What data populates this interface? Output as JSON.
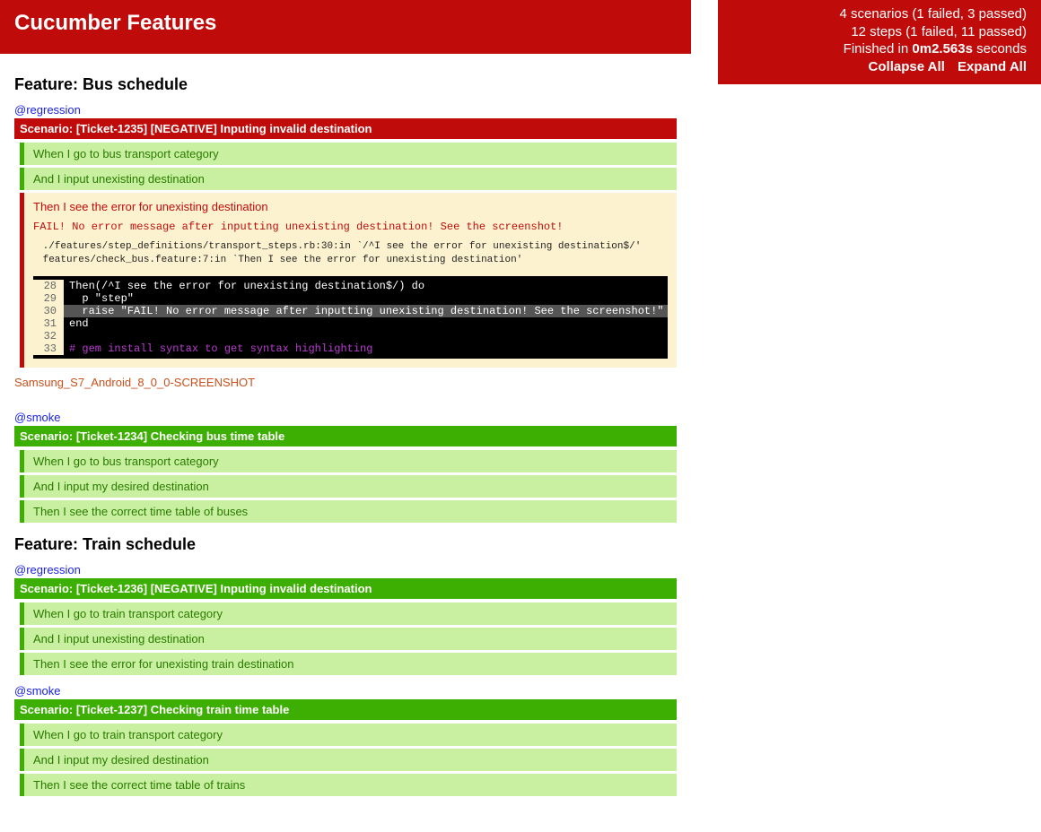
{
  "header": {
    "title": "Cucumber Features"
  },
  "summary": {
    "scenarios": "4 scenarios (1 failed, 3 passed)",
    "steps": "12 steps (1 failed, 11 passed)",
    "finished_prefix": "Finished in ",
    "finished_time": "0m2.563s",
    "finished_suffix": " seconds",
    "collapse": "Collapse All",
    "expand": "Expand All"
  },
  "features": [
    {
      "title": "Feature: Bus schedule",
      "scenarios": [
        {
          "tag": "@regression",
          "status": "failed",
          "name": "Scenario: [Ticket-1235] [NEGATIVE] Inputing invalid destination",
          "steps": [
            {
              "status": "passed",
              "text": "When I go to bus transport category"
            },
            {
              "status": "passed",
              "text": "And I input unexisting destination"
            },
            {
              "status": "failed",
              "text": "Then I see the error for unexisting destination",
              "error": "FAIL! No error message after inputting unexisting destination! See the screenshot!",
              "trace": " ./features/step_definitions/transport_steps.rb:30:in `/^I see the error for unexisting destination$/'\n features/check_bus.feature:7:in `Then I see the error for unexisting destination'",
              "code": [
                {
                  "ln": "28",
                  "src": "Then(/^I see the error for unexisting destination$/) do",
                  "hl": false,
                  "comment": false
                },
                {
                  "ln": "29",
                  "src": "  p \"step\"",
                  "hl": false,
                  "comment": false
                },
                {
                  "ln": "30",
                  "src": "  raise \"FAIL! No error message after inputting unexisting destination! See the screenshot!\"",
                  "hl": true,
                  "comment": false
                },
                {
                  "ln": "31",
                  "src": "end",
                  "hl": false,
                  "comment": false
                },
                {
                  "ln": "32",
                  "src": "",
                  "hl": false,
                  "comment": false
                },
                {
                  "ln": "33",
                  "src": "# gem install syntax to get syntax highlighting",
                  "hl": false,
                  "comment": true
                }
              ]
            }
          ],
          "screenshot": "Samsung_S7_Android_8_0_0-SCREENSHOT"
        },
        {
          "tag": "@smoke",
          "status": "passed",
          "name": "Scenario: [Ticket-1234] Checking bus time table",
          "steps": [
            {
              "status": "passed",
              "text": "When I go to bus transport category"
            },
            {
              "status": "passed",
              "text": "And I input my desired destination"
            },
            {
              "status": "passed",
              "text": "Then I see the correct time table of buses"
            }
          ]
        }
      ]
    },
    {
      "title": "Feature: Train schedule",
      "scenarios": [
        {
          "tag": "@regression",
          "status": "passed",
          "name": "Scenario: [Ticket-1236] [NEGATIVE] Inputing invalid destination",
          "steps": [
            {
              "status": "passed",
              "text": "When I go to train transport category"
            },
            {
              "status": "passed",
              "text": "And I input unexisting destination"
            },
            {
              "status": "passed",
              "text": "Then I see the error for unexisting train destination"
            }
          ]
        },
        {
          "tag": "@smoke",
          "status": "passed",
          "name": "Scenario: [Ticket-1237] Checking train time table",
          "steps": [
            {
              "status": "passed",
              "text": "When I go to train transport category"
            },
            {
              "status": "passed",
              "text": "And I input my desired destination"
            },
            {
              "status": "passed",
              "text": "Then I see the correct time table of trains"
            }
          ]
        }
      ]
    }
  ]
}
